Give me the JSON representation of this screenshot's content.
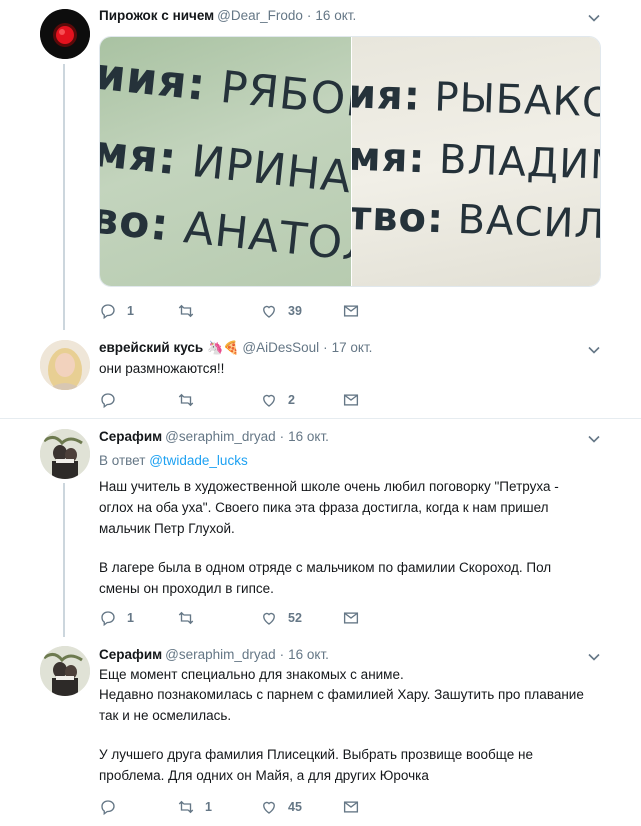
{
  "tweets": [
    {
      "name": "Пирожок с ничем",
      "handle": "@Dear_Frodo",
      "time": "16 окт.",
      "media": {
        "left_lines": [
          {
            "label": "иия:",
            "value": "РЯБОКОН"
          },
          {
            "label": "мя:",
            "value": "ИРИНА"
          },
          {
            "label": "во:",
            "value": "АНАТОЛЬ"
          }
        ],
        "right_lines": [
          {
            "label": "ия:",
            "value": "РЫБАКОНЬ"
          },
          {
            "label": "мя:",
            "value": "ВЛАДИМИ"
          },
          {
            "label": "тво:",
            "value": "ВАСИЛЬЕВ"
          }
        ]
      },
      "replies": "1",
      "retweets": "",
      "likes": "39"
    },
    {
      "name": "еврейский кусь",
      "emojis": "🦄🍕",
      "handle": "@AiDesSoul",
      "time": "17 окт.",
      "text": "они размножаются!!",
      "replies": "",
      "retweets": "",
      "likes": "2"
    },
    {
      "name": "Серафим",
      "handle": "@seraphim_dryad",
      "time": "16 окт.",
      "reply_prefix": "В ответ",
      "reply_handle": "@twidade_lucks",
      "text1": "Наш учитель в художественной школе очень любил поговорку \"Петруха - оглох на оба уха\". Своего пика эта фраза достигла, когда к нам пришел мальчик Петр Глухой.",
      "text2": "В лагере была в одном отряде с мальчиком по фамилии Скороход. Пол смены он проходил в гипсе.",
      "replies": "1",
      "retweets": "",
      "likes": "52"
    },
    {
      "name": "Серафим",
      "handle": "@seraphim_dryad",
      "time": "16 окт.",
      "text1": "Еще момент специально для знакомых с аниме.",
      "text2": "Недавно познакомилась с парнем с фамилией Хару. Зашутить про плавание так и не осмелилась.",
      "text3": "У лучшего друга фамилия Плисецкий. Выбрать прозвище вообще не проблема. Для одних он Майя, а для других Юрочка",
      "replies": "",
      "retweets": "1",
      "likes": "45"
    }
  ],
  "colors": {
    "text": "#14171a",
    "muted": "#657786",
    "link": "#1da1f2",
    "separator": "#e6ecf0"
  }
}
